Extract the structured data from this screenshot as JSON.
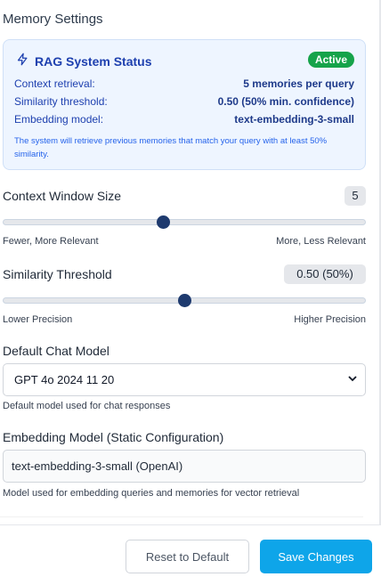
{
  "section_title": "Memory Settings",
  "rag_status": {
    "icon": "lightning-icon",
    "title": "RAG System Status",
    "badge": "Active",
    "badge_color": "#16a34a",
    "rows": [
      {
        "label": "Context retrieval:",
        "value": "5 memories per query"
      },
      {
        "label": "Similarity threshold:",
        "value": "0.50 (50% min. confidence)"
      },
      {
        "label": "Embedding model:",
        "value": "text-embedding-3-small"
      }
    ],
    "note": "The system will retrieve previous memories that match your query with at least 50% similarity."
  },
  "context_window": {
    "label": "Context Window Size",
    "value": "5",
    "position": 0.44,
    "min_label": "Fewer, More Relevant",
    "max_label": "More, Less Relevant"
  },
  "similarity_threshold": {
    "label": "Similarity Threshold",
    "value": "0.50 (50%)",
    "position": 0.5,
    "min_label": "Lower Precision",
    "max_label": "Higher Precision"
  },
  "chat_model": {
    "label": "Default Chat Model",
    "selected": "GPT 4o 2024 11 20",
    "help": "Default model used for chat responses"
  },
  "embedding_model": {
    "label": "Embedding Model (Static Configuration)",
    "value": "text-embedding-3-small (OpenAI)",
    "help": "Model used for embedding queries and memories for vector retrieval"
  },
  "footer": {
    "reset_label": "Reset to Default",
    "save_label": "Save Changes"
  },
  "colors": {
    "accent": "#0ea5e9",
    "status_bg": "#eef5ff",
    "status_text": "#1e40af",
    "slider_thumb": "#1e3a6e"
  }
}
